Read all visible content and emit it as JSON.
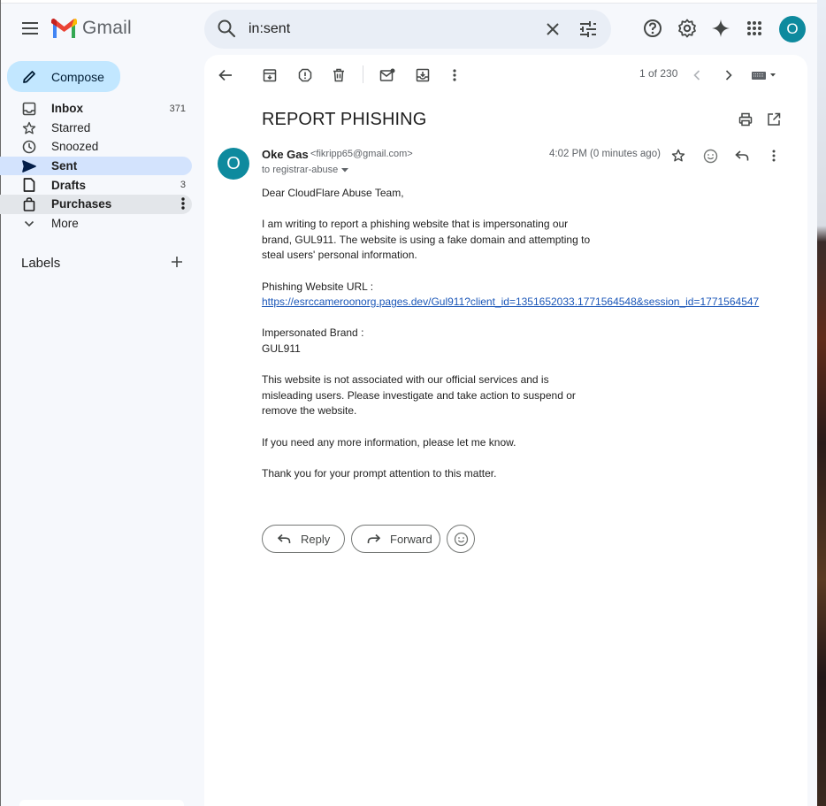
{
  "app": {
    "name": "Gmail"
  },
  "header": {
    "search_value": "in:sent",
    "avatar_initial": "O",
    "icons": [
      "menu-icon",
      "search-icon",
      "close-icon",
      "tune-icon",
      "help-icon",
      "gear-icon",
      "gemini-sparkle-icon",
      "apps-grid-icon"
    ]
  },
  "sidebar": {
    "compose_label": "Compose",
    "items": [
      {
        "label": "Inbox",
        "count": "371",
        "icon": "inbox-icon"
      },
      {
        "label": "Starred",
        "count": "",
        "icon": "star-icon"
      },
      {
        "label": "Snoozed",
        "count": "",
        "icon": "clock-icon"
      },
      {
        "label": "Sent",
        "count": "",
        "icon": "send-icon"
      },
      {
        "label": "Drafts",
        "count": "3",
        "icon": "draft-icon"
      },
      {
        "label": "Purchases",
        "count": "",
        "icon": "shopping-bag-icon"
      },
      {
        "label": "More",
        "count": "",
        "icon": "chevron-down-icon"
      }
    ],
    "labels_title": "Labels"
  },
  "toolbar": {
    "pager": "1 of 230"
  },
  "message": {
    "subject": "REPORT PHISHING",
    "sender_name": "Oke Gas",
    "sender_email": "<fikripp65@gmail.com>",
    "to": "to registrar-abuse",
    "time": "4:02 PM (0 minutes ago)",
    "avatar_initial": "O",
    "greeting": "Dear CloudFlare Abuse Team,",
    "para1_line1": "I am writing to report a phishing website that is impersonating our",
    "para1_line2": "brand, GUL911. The website is using a fake domain and attempting to",
    "para1_line3": "steal users' personal information.",
    "url_label": "Phishing Website URL :",
    "url": "https://esrccameroonorg.pages.dev/Gul911?client_id=1351652033.1771564548&session_id=1771564547",
    "brand_label": "Impersonated Brand :",
    "brand": "GUL911",
    "para2_line1": "This website is not associated with our official services and is",
    "para2_line2": "misleading users. Please investigate and take action to suspend or",
    "para2_line3": "remove the website.",
    "para3": "If you need any more information, please let me know.",
    "para4": "Thank you for your prompt attention to this matter."
  },
  "actions": {
    "reply_label": "Reply",
    "forward_label": "Forward"
  },
  "colors": {
    "compose_bg": "#c2e7ff",
    "active_nav": "#d3e3fd",
    "avatar": "#0e8a9e",
    "link": "#1a56b8"
  }
}
